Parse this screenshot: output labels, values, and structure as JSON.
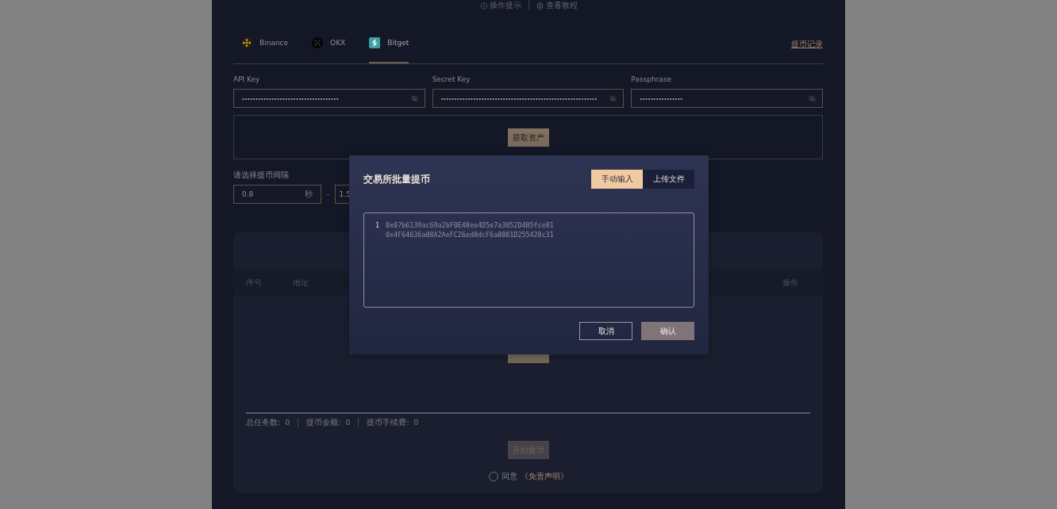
{
  "top_links": [
    {
      "kind": "info",
      "label": "操作提示"
    },
    {
      "kind": "doc",
      "label": "查看教程"
    }
  ],
  "exchange_tabs": [
    {
      "label": "Binance",
      "kind": "binance",
      "selected": false
    },
    {
      "label": "OKX",
      "kind": "okx",
      "selected": false
    },
    {
      "label": "Bitget",
      "kind": "bitget",
      "selected": true
    }
  ],
  "history_link": "提币记录",
  "credentials": [
    {
      "label": "API Key",
      "value": "••••••••••••••••••••••••••••••••••••"
    },
    {
      "label": "Secret Key",
      "value": "••••••••••••••••••••••••••••••••••••••••••••••••••••••••••"
    },
    {
      "label": "Passphrase",
      "value": "••••••••••••••••"
    }
  ],
  "fetch_button": "获取资产",
  "interval": {
    "label": "请选择提币间隔",
    "min": {
      "value": "0.8",
      "unit": "秒"
    },
    "separator": "–",
    "max": {
      "value": "1.5"
    }
  },
  "table": {
    "columns": [
      "序号",
      "地址",
      "操作"
    ]
  },
  "stats": [
    {
      "label": "总任务数:",
      "value": "0"
    },
    {
      "label": "提币金额:",
      "value": "0"
    },
    {
      "label": "提币手续费:",
      "value": "0"
    }
  ],
  "start_button": {
    "label": "开始提币",
    "disabled": true
  },
  "agreement": {
    "checked": false,
    "text": "同意",
    "link": "《免责声明》"
  },
  "modal": {
    "title": "交易所批量提币",
    "modes": [
      {
        "label": "手动输入",
        "selected": true
      },
      {
        "label": "上传文件",
        "selected": false
      }
    ],
    "lines": [
      {
        "number": "1",
        "text": "0x07b6139ac69a2bF0E48ee4D5e7a3052D4B5fce81"
      },
      {
        "text": "0x4F64636a08A2AeFC26ed8dcF6a8881D255428c31"
      }
    ],
    "buttons": [
      {
        "kind": "secondary",
        "label": "取消"
      },
      {
        "kind": "primary",
        "label": "确认"
      }
    ]
  }
}
